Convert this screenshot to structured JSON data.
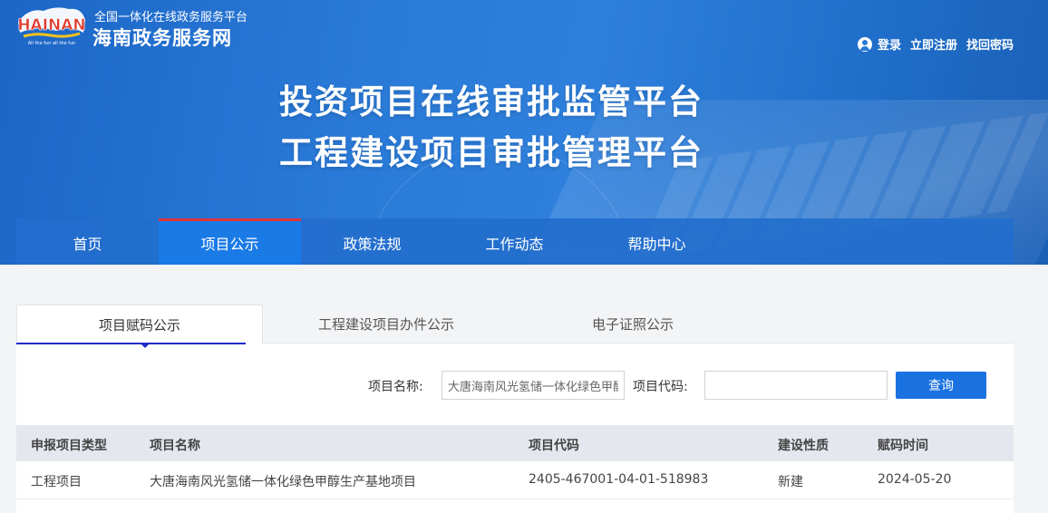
{
  "header": {
    "logo_text": "HAINAN",
    "logo_subtext": "All the fun all the fun",
    "site_subtitle": "全国一体化在线政务服务平台",
    "site_title": "海南政务服务网",
    "user_links": {
      "login": "登录",
      "register": "立即注册",
      "recover_password": "找回密码"
    },
    "banner_line1": "投资项目在线审批监管平台",
    "banner_line2": "工程建设项目审批管理平台"
  },
  "nav": {
    "items": [
      {
        "label": "首页"
      },
      {
        "label": "项目公示"
      },
      {
        "label": "政策法规"
      },
      {
        "label": "工作动态"
      },
      {
        "label": "帮助中心"
      }
    ],
    "active_index": 1
  },
  "tabs": {
    "items": [
      {
        "label": "项目赋码公示"
      },
      {
        "label": "工程建设项目办件公示"
      },
      {
        "label": "电子证照公示"
      }
    ],
    "active_index": 0
  },
  "search": {
    "name_label": "项目名称:",
    "name_value": "大唐海南风光氢储一体化绿色甲醇生产基地项目",
    "code_label": "项目代码:",
    "code_value": "",
    "query_button": "查询"
  },
  "table": {
    "columns": [
      "申报项目类型",
      "项目名称",
      "项目代码",
      "建设性质",
      "赋码时间"
    ],
    "rows": [
      {
        "type": "工程项目",
        "name": "大唐海南风光氢储一体化绿色甲醇生产基地项目",
        "code": "2405-467001-04-01-518983",
        "nature": "新建",
        "date": "2024-05-20"
      }
    ]
  },
  "colors": {
    "header_blue": "#2a7ad8",
    "nav_active": "#1a7ae6",
    "nav_active_top": "#e3343a",
    "tab_underline": "#1f2ccc",
    "button_blue": "#1a72e0"
  },
  "icons": {
    "user": "user-icon",
    "logo": "hainan-logo"
  }
}
